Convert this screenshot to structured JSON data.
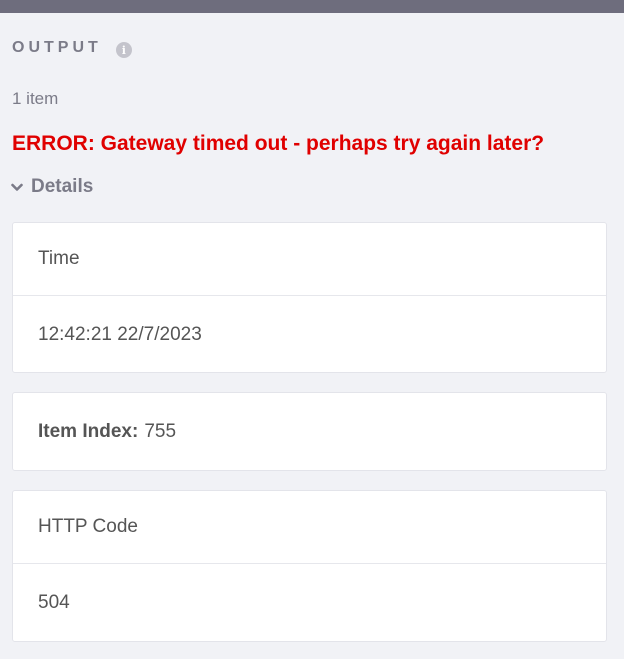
{
  "panel": {
    "title": "OUTPUT",
    "info_icon": "info-icon",
    "item_count": "1 item"
  },
  "error": {
    "message": "ERROR: Gateway timed out - perhaps try again later?",
    "color": "#e00000"
  },
  "details": {
    "toggle_label": "Details",
    "toggle_icon": "chevron-down-icon",
    "time": {
      "label": "Time",
      "value": "12:42:21 22/7/2023"
    },
    "item_index": {
      "label": "Item Index:",
      "value": "755"
    },
    "http_code": {
      "label": "HTTP Code",
      "value": "504"
    }
  }
}
